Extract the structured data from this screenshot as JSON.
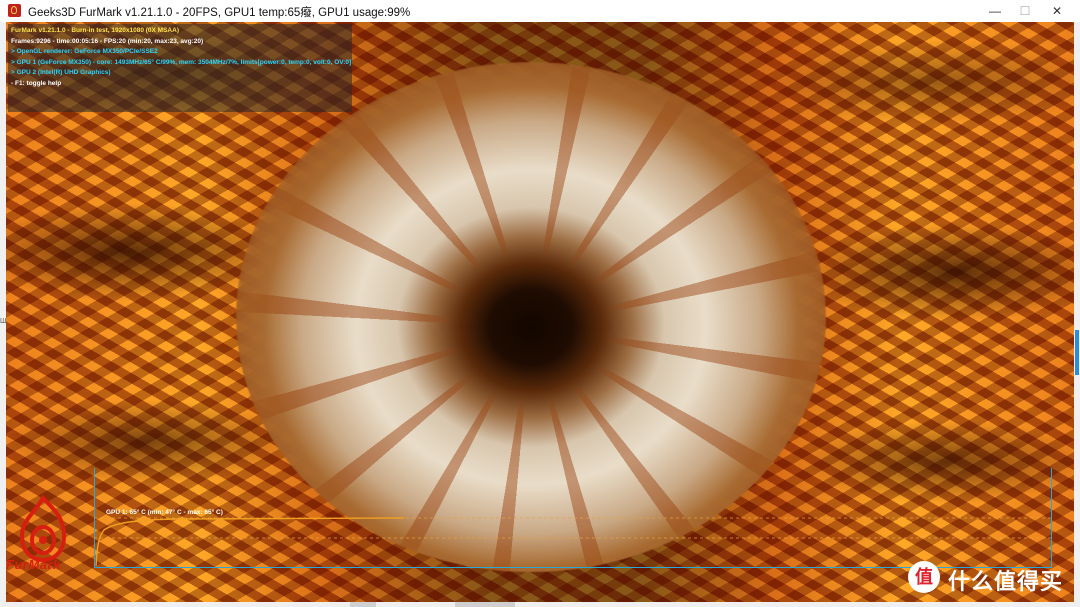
{
  "window": {
    "title": "Geeks3D FurMark v1.21.1.0 - 20FPS, GPU1 temp:65癈, GPU1 usage:99%",
    "minimize_glyph": "—",
    "maximize_glyph": "☐",
    "close_glyph": "✕"
  },
  "hud": {
    "lines": [
      "FurMark v1.21.1.0 - Burn-in test, 1920x1080 (0X MSAA)",
      "Frames:9296 - time:00:05:16 - FPS:20 (min:20, max:23, avg:20)",
      "> OpenGL renderer: GeForce MX350/PCIe/SSE2",
      "> GPU 1 (GeForce MX350) - core: 1493MHz/65° C/99%, mem: 3504MHz/7%, limits[power:0, temp:0, volt:0, OV:0]",
      "> GPU 2 (Intel(R) UHD Graphics)",
      "- F1: toggle help"
    ]
  },
  "graph": {
    "label": "GPU 1: 65° C (min: 47° C - max: 65° C)",
    "line_color": "#f0a020",
    "border_color": "#2aa8d8"
  },
  "logo": {
    "text": "FurMark"
  },
  "watermark": {
    "glyph": "值",
    "text": "什么值得买"
  },
  "left_fragment": "Ш"
}
